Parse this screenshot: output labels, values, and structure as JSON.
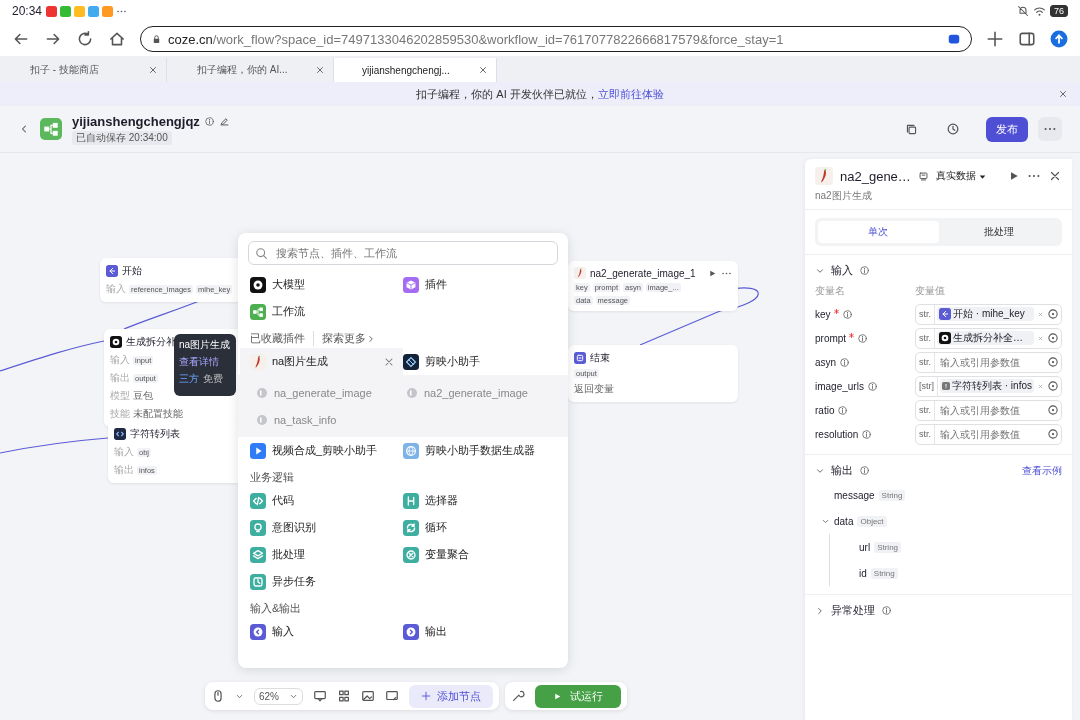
{
  "status_bar": {
    "time": "20:34",
    "battery": "76"
  },
  "browser": {
    "url_host": "coze.cn",
    "url_path": "/work_flow?space_id=7497133046202859530&workflow_id=7617077822666817579&force_stay=1"
  },
  "tabs": [
    {
      "label": "扣子 - 技能商店",
      "selected": false
    },
    {
      "label": "扣子编程，你的 AI...",
      "selected": false
    },
    {
      "label": "yijianshengchengj...",
      "selected": true
    }
  ],
  "banner": {
    "text": "扣子编程，你的 AI 开发伙伴已就位，",
    "link": "立即前往体验"
  },
  "header": {
    "title": "yijianshengchengjqz",
    "saved": "已自动保存 20:34:00",
    "publish": "发布"
  },
  "nodes": [
    {
      "kind": "start",
      "title": "开始",
      "rows": [
        {
          "label": "输入",
          "tags": [
            "reference_images",
            "mihe_key"
          ]
        }
      ]
    },
    {
      "kind": "llm",
      "title": "生成拆分补",
      "rows": [
        {
          "label": "输入",
          "tags": [
            "input"
          ]
        },
        {
          "label": "输出",
          "tags": [
            "output"
          ]
        },
        {
          "label": "模型",
          "text": "豆包"
        },
        {
          "label": "技能",
          "text": "未配置技能"
        }
      ]
    },
    {
      "kind": "strlist",
      "title": "字符转列表",
      "rows": [
        {
          "label": "输入",
          "tags": [
            "obj"
          ]
        },
        {
          "label": "输出",
          "tags": [
            "infos"
          ]
        }
      ]
    },
    {
      "kind": "pepper",
      "title": "na2_generate_image_1",
      "rows": [
        {
          "tags": [
            "key",
            "prompt",
            "asyn",
            "image_..."
          ]
        },
        {
          "tags": [
            "data",
            "message"
          ]
        }
      ]
    },
    {
      "kind": "end",
      "title": "结束",
      "rows": [
        {
          "tags": [
            "output"
          ]
        },
        {
          "text": "返回变量"
        }
      ]
    }
  ],
  "tooltip": {
    "title": "na图片生成",
    "link": "查看详情",
    "tags": [
      "三方",
      "免费"
    ]
  },
  "add_menu": {
    "search_placeholder": "搜索节点、插件、工作流",
    "top_items": [
      {
        "kind": "llm",
        "label": "大模型"
      },
      {
        "kind": "plugin",
        "label": "插件"
      },
      {
        "kind": "workflow",
        "label": "工作流"
      }
    ],
    "favorites": {
      "title": "已收藏插件",
      "more": "探索更多"
    },
    "plugins": [
      {
        "kind": "pepper",
        "label": "na图片生成",
        "selected": true
      },
      {
        "kind": "capcut",
        "label": "剪映小助手",
        "selected": false
      },
      {
        "kind": "video",
        "label": "视频合成_剪映小助手",
        "selected": false
      },
      {
        "kind": "globe",
        "label": "剪映小助手数据生成器",
        "selected": false
      }
    ],
    "tools": [
      "na_generate_image",
      "na2_generate_image",
      "na_task_info"
    ],
    "sections": [
      {
        "title": "业务逻辑",
        "items": [
          {
            "kind": "code",
            "label": "代码"
          },
          {
            "kind": "if",
            "label": "选择器"
          },
          {
            "kind": "intent",
            "label": "意图识别"
          },
          {
            "kind": "loop",
            "label": "循环"
          },
          {
            "kind": "batch",
            "label": "批处理"
          },
          {
            "kind": "merge",
            "label": "变量聚合"
          },
          {
            "kind": "async",
            "label": "异步任务"
          }
        ]
      },
      {
        "title": "输入&输出",
        "items": [
          {
            "kind": "input",
            "label": "输入"
          },
          {
            "kind": "output",
            "label": "输出"
          }
        ]
      }
    ]
  },
  "toolbar": {
    "zoom": "62%",
    "add_node": "添加节点",
    "run": "试运行"
  },
  "panel": {
    "title": "na2_gene…",
    "mode": "真实数据",
    "subtitle": "na2图片生成",
    "tabs": [
      {
        "label": "单次",
        "selected": true
      },
      {
        "label": "批处理",
        "selected": false
      }
    ],
    "input": {
      "title": "输入",
      "expanded": true,
      "col_name": "变量名",
      "col_value": "变量值",
      "params": [
        {
          "name": "key",
          "required": true,
          "type": "str.",
          "ref": {
            "kind": "start",
            "text": "开始 · mihe_key"
          }
        },
        {
          "name": "prompt",
          "required": true,
          "type": "str.",
          "ref": {
            "kind": "llm",
            "text": "生成拆分补全…"
          }
        },
        {
          "name": "asyn",
          "required": false,
          "type": "str.",
          "placeholder": "输入或引用参数值"
        },
        {
          "name": "image_urls",
          "required": false,
          "type": "[str]",
          "ref": {
            "kind": "warn",
            "text": "字符转列表 · infos"
          }
        },
        {
          "name": "ratio",
          "required": false,
          "type": "str.",
          "placeholder": "输入或引用参数值"
        },
        {
          "name": "resolution",
          "required": false,
          "type": "str.",
          "placeholder": "输入或引用参数值"
        }
      ]
    },
    "output": {
      "title": "输出",
      "expanded": true,
      "link": "查看示例",
      "fields": [
        {
          "name": "message",
          "type": "String"
        },
        {
          "name": "data",
          "type": "Object",
          "expanded": true,
          "children": [
            {
              "name": "url",
              "type": "String"
            },
            {
              "name": "id",
              "type": "String"
            }
          ]
        }
      ]
    },
    "error": {
      "title": "异常处理",
      "expanded": false
    }
  }
}
